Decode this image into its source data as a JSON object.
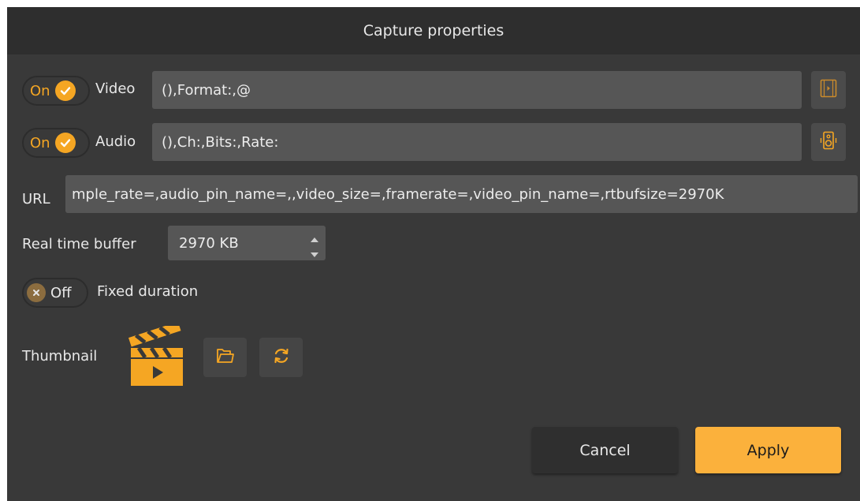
{
  "dialog": {
    "title": "Capture properties"
  },
  "video": {
    "toggle_label": "On",
    "label": "Video",
    "value": "(),Format:,@",
    "icon": "film-icon"
  },
  "audio": {
    "toggle_label": "On",
    "label": "Audio",
    "value": "(),Ch:,Bits:,Rate:",
    "icon": "speaker-icon"
  },
  "url": {
    "label": "URL",
    "value": "mple_rate=,audio_pin_name=,,video_size=,framerate=,video_pin_name=,rtbufsize=2970K"
  },
  "buffer": {
    "label": "Real time buffer",
    "value": "2970 KB"
  },
  "fixed_duration": {
    "toggle_label": "Off",
    "label": "Fixed duration"
  },
  "thumbnail": {
    "label": "Thumbnail",
    "image_icon": "clapperboard-icon",
    "open_icon": "folder-open-icon",
    "reset_icon": "refresh-icon"
  },
  "actions": {
    "cancel_label": "Cancel",
    "apply_label": "Apply"
  },
  "colors": {
    "accent": "#f5a623",
    "apply_bg": "#fbb13c",
    "background": "#393939",
    "titlebar": "#2e2e2e",
    "field": "#565656"
  }
}
